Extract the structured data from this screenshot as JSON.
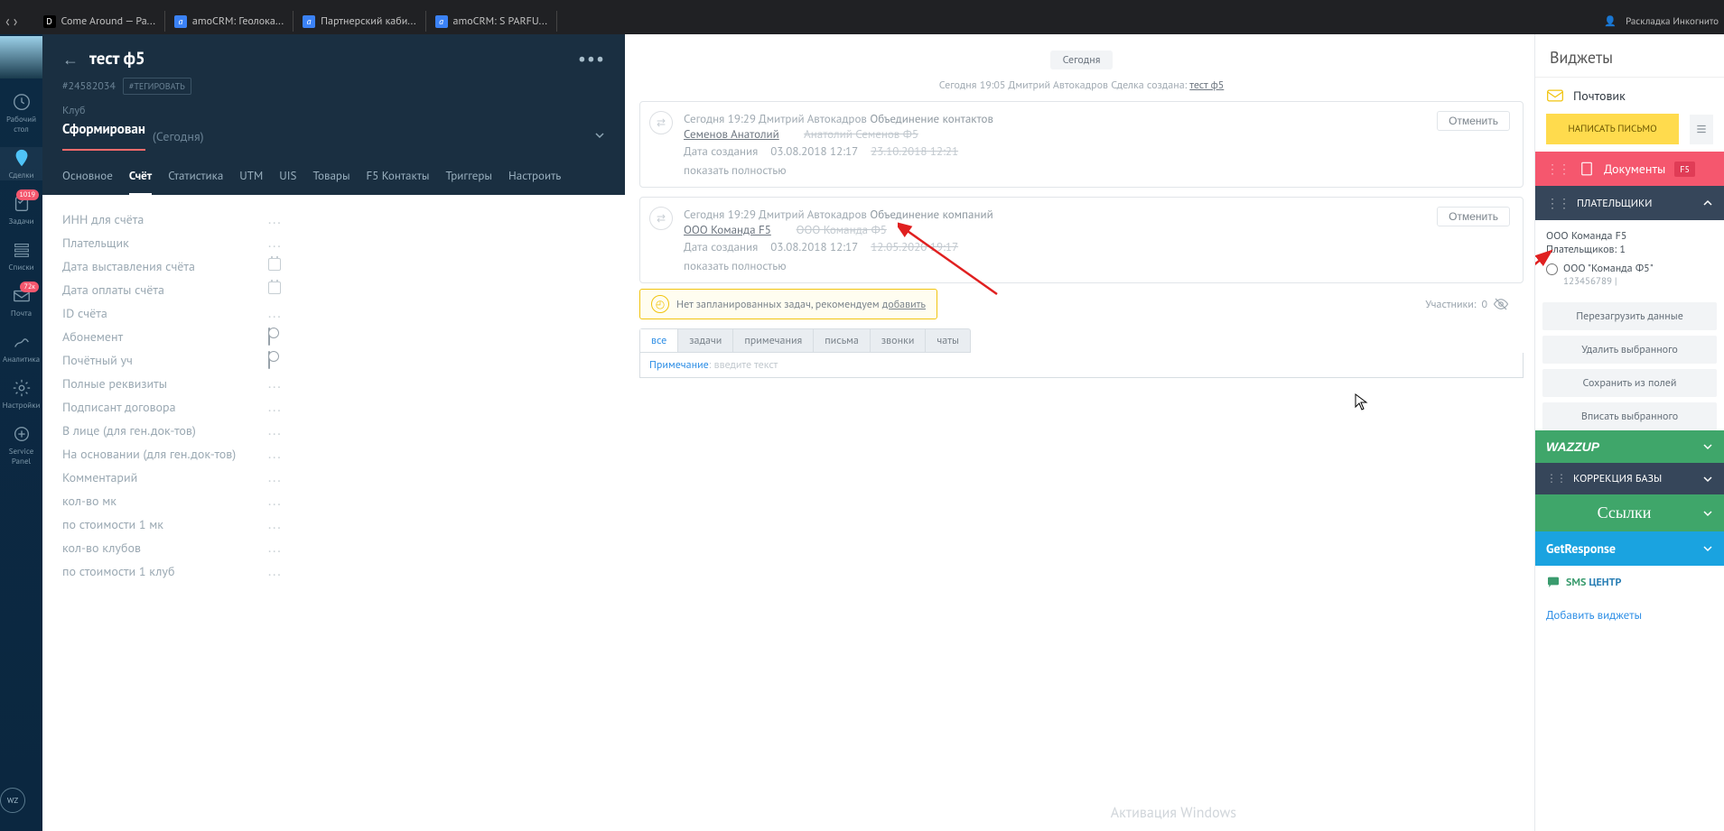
{
  "browser": {
    "tabs": [
      {
        "favicon": "D",
        "label": "Come Around — Pa..."
      },
      {
        "favicon": "a",
        "label": "amoCRM: Геолока..."
      },
      {
        "favicon": "a",
        "label": "Партнерский каби..."
      },
      {
        "favicon": "a",
        "label": "amoCRM: S PARFU..."
      }
    ],
    "right_text": "Раскладка Инкогнито"
  },
  "left_nav": {
    "items": [
      {
        "id": "desktop",
        "label": "Рабочий стол"
      },
      {
        "id": "deals",
        "label": "Сделки"
      },
      {
        "id": "tasks",
        "label": "Задачи",
        "badge": "1019"
      },
      {
        "id": "lists",
        "label": "Списки"
      },
      {
        "id": "mail",
        "label": "Почта",
        "badge": "72к"
      },
      {
        "id": "analytics",
        "label": "Аналитика"
      },
      {
        "id": "settings",
        "label": "Настройки"
      },
      {
        "id": "service",
        "label": "Service Panel"
      }
    ],
    "bottom": "WZ"
  },
  "detail": {
    "title": "тест ф5",
    "id": "#24582034",
    "tag_btn": "#ТЕГИРОВАТЬ",
    "group_label": "Клуб",
    "status": "Сформирован",
    "status_suffix": "(Сегодня)",
    "tabs": [
      "Основное",
      "Счёт",
      "Статистика",
      "UTM",
      "UIS",
      "Товары",
      "F5 Контакты",
      "Триггеры",
      "Настроить"
    ],
    "active_tab": "Счёт",
    "fields": [
      {
        "label": "ИНН для счёта",
        "type": "text"
      },
      {
        "label": "Плательщик",
        "type": "text"
      },
      {
        "label": "Дата выставления счёта",
        "type": "date"
      },
      {
        "label": "Дата оплаты счёта",
        "type": "date"
      },
      {
        "label": "ID счёта",
        "type": "text"
      },
      {
        "label": "Абонемент",
        "type": "toggle"
      },
      {
        "label": "Почётный уч",
        "type": "toggle"
      },
      {
        "label": "Полные реквизиты",
        "type": "text"
      },
      {
        "label": "Подписант договора",
        "type": "text"
      },
      {
        "label": "В лице (для ген.док-тов)",
        "type": "text"
      },
      {
        "label": "На основании (для ген.док-тов)",
        "type": "text"
      },
      {
        "label": "Комментарий",
        "type": "text"
      },
      {
        "label": "кол-во мк",
        "type": "text"
      },
      {
        "label": "по стоимости 1 мк",
        "type": "text"
      },
      {
        "label": "кол-во клубов",
        "type": "text"
      },
      {
        "label": "по стоимости 1 клуб",
        "type": "text"
      }
    ]
  },
  "feed": {
    "today_label": "Сегодня",
    "created_meta_prefix": "Сегодня 19:05 Дмитрий Автокадров  Сделка создана: ",
    "created_meta_link": "тест ф5",
    "cards": [
      {
        "meta": "Сегодня 19:29 Дмитрий Автокадров",
        "action": "Объединение контактов",
        "title_new": "Семенов Анатолий",
        "title_old": "Анатолий Семенов Ф5",
        "date_label": "Дата создания",
        "date_new": "03.08.2018 12:17",
        "date_old": "23.10.2018 12:21",
        "show_full": "показать полностью",
        "cancel": "Отменить"
      },
      {
        "meta": "Сегодня 19:29 Дмитрий Автокадров",
        "action": "Объединение компаний",
        "title_new": "ООО Команда F5",
        "title_old": "ООО Команда Ф5",
        "date_label": "Дата создания",
        "date_new": "03.08.2018 12:17",
        "date_old": "12.05.2020 19:17",
        "show_full": "показать полностью",
        "cancel": "Отменить"
      }
    ],
    "no_tasks_text": "Нет запланированных задач, рекомендуем ",
    "no_tasks_link": "добавить",
    "participants_label": "Участники: ",
    "participants_count": "0",
    "bottom_tabs": [
      "все",
      "задачи",
      "примечания",
      "письма",
      "звонки",
      "чаты"
    ],
    "bottom_active": "все",
    "note_prefix": "Примечание",
    "note_placeholder": ": введите текст"
  },
  "widgets": {
    "title": "Виджеты",
    "mail_label": "Почтовик",
    "write_btn": "НАПИСАТЬ ПИСЬМО",
    "docs_label": "Документы",
    "docs_badge": "F5",
    "payers_label": "ПЛАТЕЛЬЩИКИ",
    "payers_company": "ООО Команда F5",
    "payers_count_label": "Плательщиков: 1",
    "payers": [
      {
        "name": "ООО \"Команда Ф5\"",
        "inn": "123456789 |"
      }
    ],
    "buttons": [
      "Перезагрузить данные",
      "Удалить выбранного",
      "Сохранить из полей",
      "Вписать выбранного"
    ],
    "wazzup": "WAZZUP",
    "korr": "КОРРЕКЦИЯ БАЗЫ",
    "links": "Ссылки",
    "getresponse": "GetResponse",
    "sms_green": "SMS",
    "sms_blue": " ЦЕНТР",
    "add_widgets": "Добавить виджеты"
  },
  "watermark": "Активация Windows"
}
